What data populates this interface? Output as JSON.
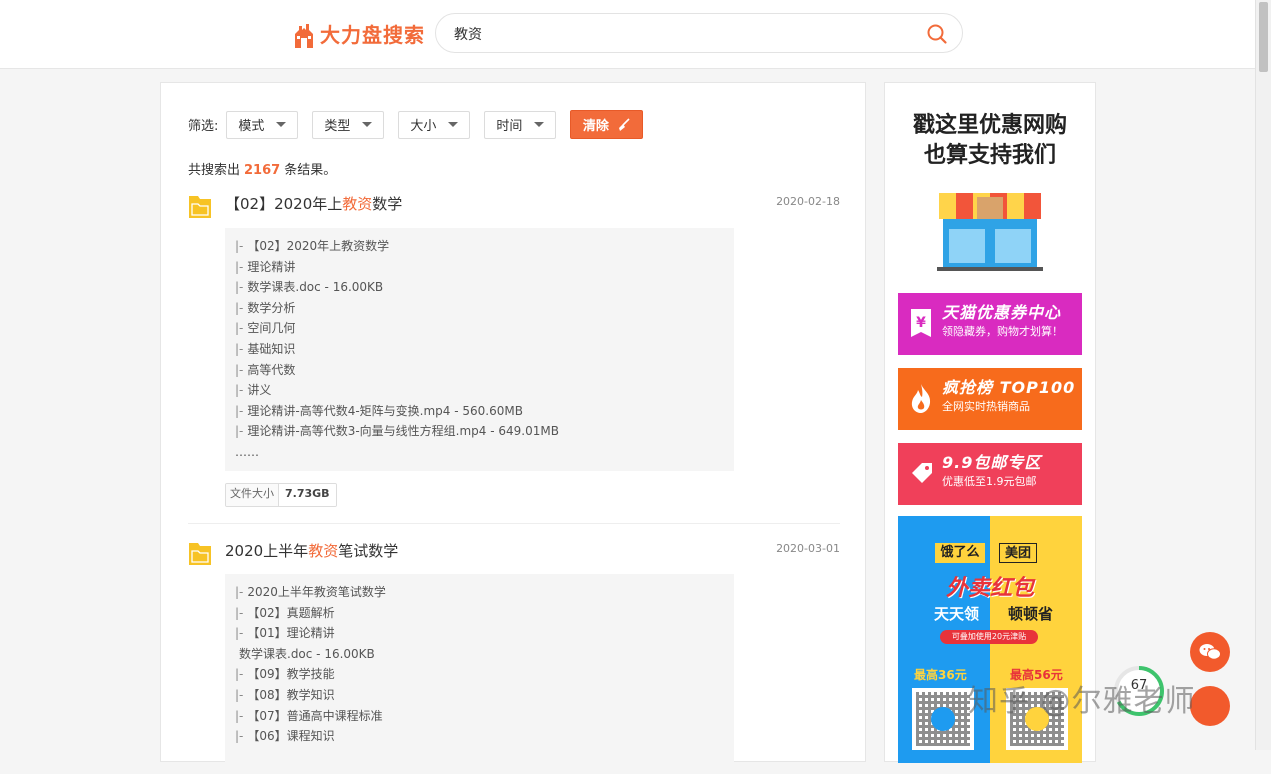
{
  "header": {
    "logo_text": "大力盘搜索",
    "search_value": "教资"
  },
  "filters": {
    "label": "筛选:",
    "dropdowns": [
      "模式",
      "类型",
      "大小",
      "时间"
    ],
    "clear_label": "清除"
  },
  "summary": {
    "prefix": "共搜索出",
    "count": "2167",
    "suffix": "条结果。"
  },
  "results": [
    {
      "title_pre": "【02】2020年上",
      "title_hl": "教资",
      "title_post": "数学",
      "date": "2020-02-18",
      "files": [
        {
          "pipe": "|-",
          "text": "【02】2020年上教资数学"
        },
        {
          "pipe": "|-",
          "text": "理论精讲"
        },
        {
          "pipe": "|-",
          "text": "数学课表.doc - 16.00KB"
        },
        {
          "pipe": "|-",
          "text": "数学分析"
        },
        {
          "pipe": "|-",
          "text": "空间几何"
        },
        {
          "pipe": "|-",
          "text": "基础知识"
        },
        {
          "pipe": "|-",
          "text": "高等代数"
        },
        {
          "pipe": "|-",
          "text": "讲义"
        },
        {
          "pipe": "|-",
          "text": "理论精讲-高等代数4-矩阵与变换.mp4 - 560.60MB"
        },
        {
          "pipe": "|-",
          "text": "理论精讲-高等代数3-向量与线性方程组.mp4 - 649.01MB"
        }
      ],
      "ellipsis": "……",
      "size_label": "文件大小",
      "size_value": "7.73GB"
    },
    {
      "title_pre": "2020上半年",
      "title_hl": "教资",
      "title_post": "笔试数学",
      "date": "2020-03-01",
      "files": [
        {
          "pipe": "|-",
          "text": "2020上半年教资笔试数学"
        },
        {
          "pipe": "|-",
          "text": "【02】真题解析"
        },
        {
          "pipe": "|-",
          "text": "【01】理论精讲"
        },
        {
          "pipe": "",
          "text": "数学课表.doc - 16.00KB"
        },
        {
          "pipe": "|-",
          "text": "【09】教学技能"
        },
        {
          "pipe": "|-",
          "text": "【08】教学知识"
        },
        {
          "pipe": "|-",
          "text": "【07】普通高中课程标准"
        },
        {
          "pipe": "|-",
          "text": "【06】课程知识"
        }
      ]
    }
  ],
  "sidebar": {
    "title_line1": "戳这里优惠网购",
    "title_line2": "也算支持我们",
    "promos": [
      {
        "title": "天猫优惠券中心",
        "sub": "领隐藏券，购物才划算！",
        "color": "#d92bc0",
        "icon": "yen-icon"
      },
      {
        "title": "疯抢榜 TOP100",
        "sub": "全网实时热销商品",
        "color": "#f76b1c",
        "icon": "flame-icon"
      },
      {
        "title": "9.9包邮专区",
        "sub": "优惠低至1.9元包邮",
        "color": "#f0405a",
        "icon": "tag-icon"
      }
    ],
    "ad": {
      "brand1": "饿了么",
      "brand2": "美团",
      "headline": "外卖红包",
      "daily1": "天天领",
      "daily2": "顿顿省",
      "pill": "可叠加使用20元津贴",
      "max1": "最高36元",
      "max2": "最高56元"
    }
  },
  "floating": {
    "progress": "67",
    "watermark": "知乎 @尔雅老师"
  }
}
